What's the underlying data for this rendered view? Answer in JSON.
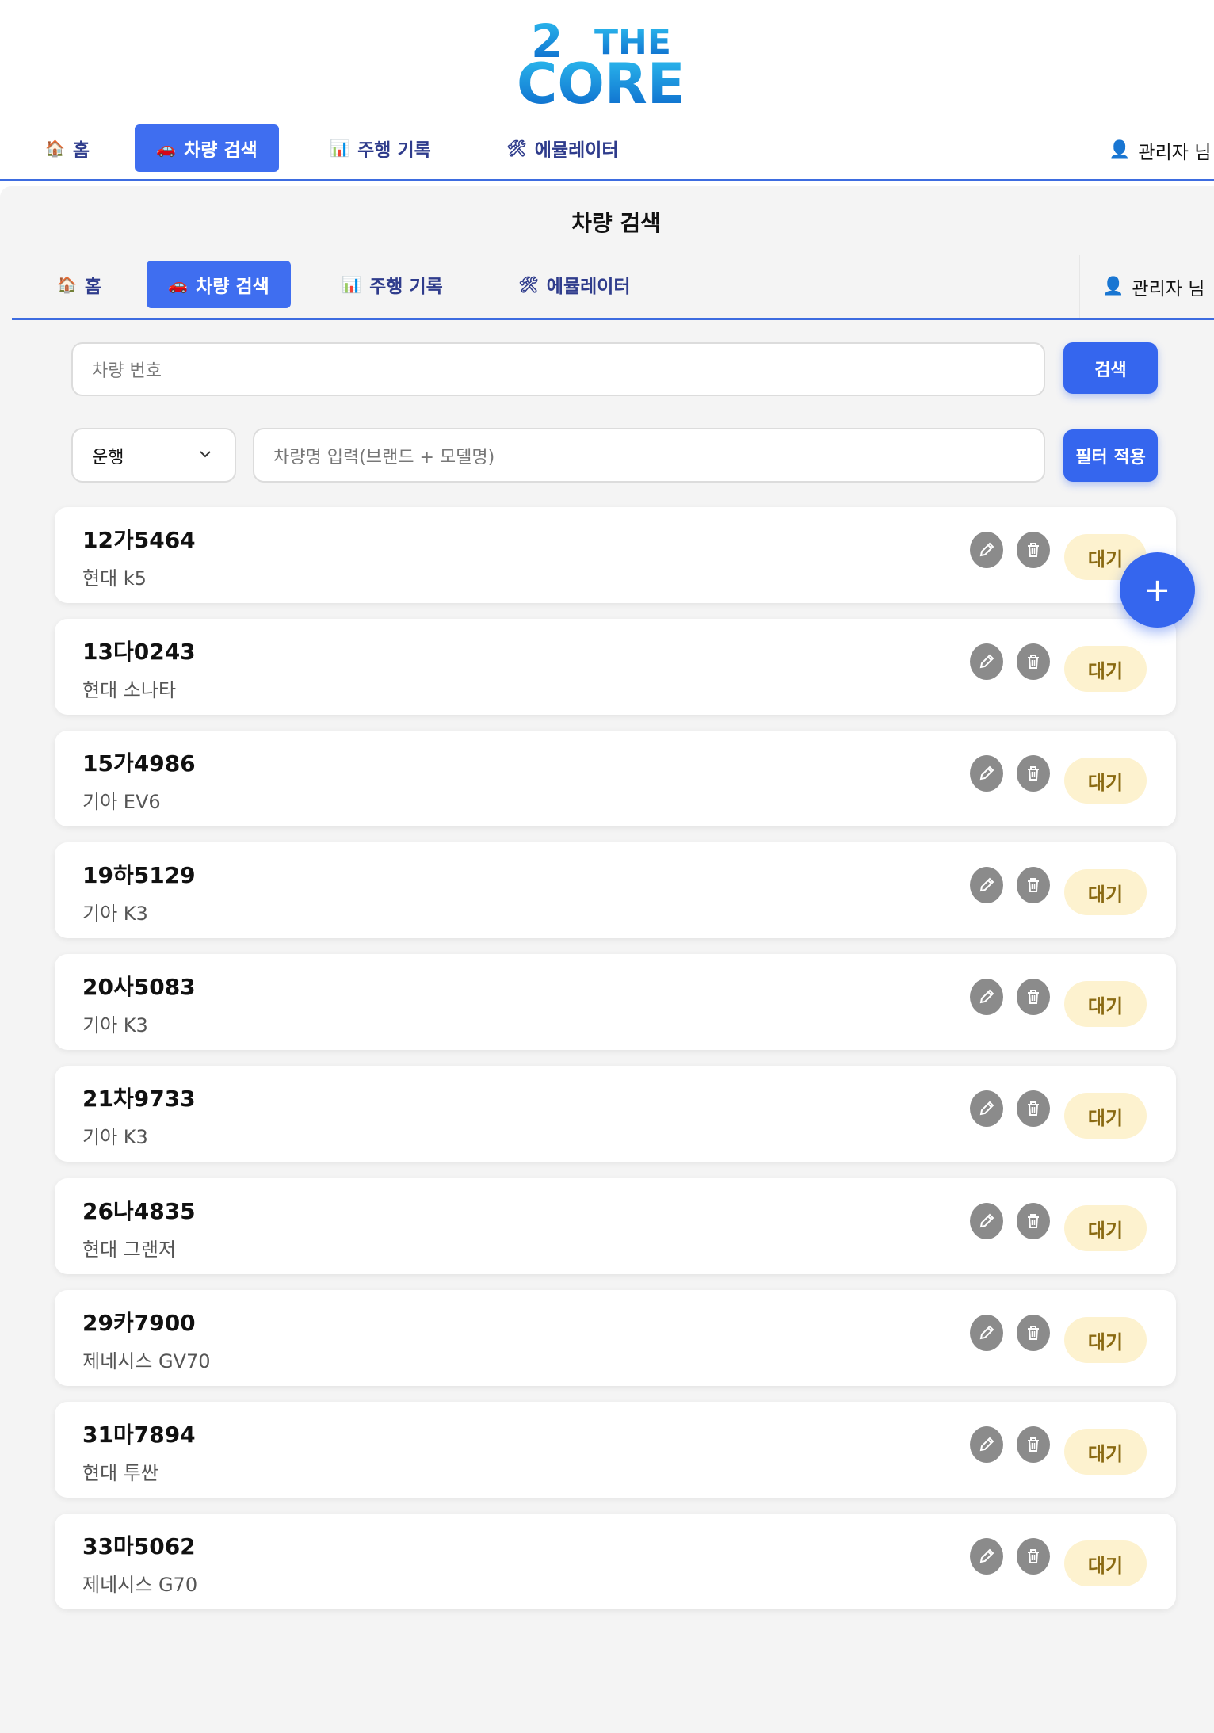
{
  "brand": {
    "line1_num": "2",
    "line1_word": "THE",
    "line2": "CORE"
  },
  "topnav": {
    "items": [
      {
        "icon": "🏠",
        "label": "홈"
      },
      {
        "icon": "🚗",
        "label": "차량 검색"
      },
      {
        "icon": "📊",
        "label": "주행 기록"
      },
      {
        "icon": "🛠",
        "label": "에뮬레이터"
      }
    ],
    "user": {
      "icon": "👤",
      "label": "관리자 님"
    }
  },
  "page": {
    "title": "차량 검색"
  },
  "search": {
    "placeholder": "차량 번호",
    "button": "검색",
    "status_selected": "운행",
    "name_placeholder": "차량명 입력(브랜드 + 모델명)",
    "filter_button": "필터 적용"
  },
  "vehicles": [
    {
      "plate": "12가5464",
      "model": "현대 k5",
      "status": "대기"
    },
    {
      "plate": "13다0243",
      "model": "현대 소나타",
      "status": "대기"
    },
    {
      "plate": "15가4986",
      "model": "기아 EV6",
      "status": "대기"
    },
    {
      "plate": "19하5129",
      "model": "기아 K3",
      "status": "대기"
    },
    {
      "plate": "20사5083",
      "model": "기아 K3",
      "status": "대기"
    },
    {
      "plate": "21차9733",
      "model": "기아 K3",
      "status": "대기"
    },
    {
      "plate": "26나4835",
      "model": "현대 그랜저",
      "status": "대기"
    },
    {
      "plate": "29카7900",
      "model": "제네시스 GV70",
      "status": "대기"
    },
    {
      "plate": "31마7894",
      "model": "현대 투싼",
      "status": "대기"
    },
    {
      "plate": "33마5062",
      "model": "제네시스 G70",
      "status": "대기"
    }
  ],
  "fab": {
    "label": "+"
  },
  "colors": {
    "accent": "#3566ee",
    "nav_text": "#2f3c8c",
    "status_bg": "#fdf2cf",
    "panel_bg": "#f4f4f4"
  }
}
